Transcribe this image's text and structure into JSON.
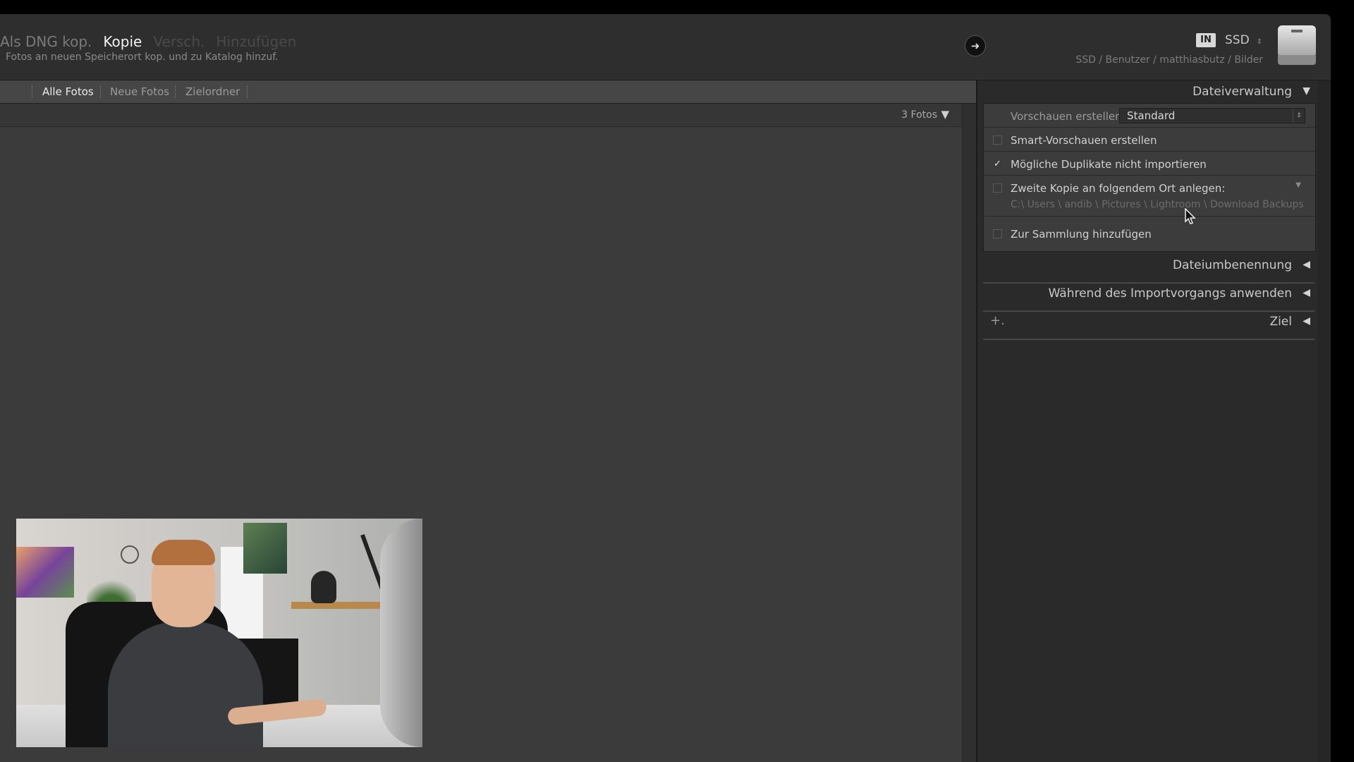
{
  "app": {
    "modes": [
      {
        "label": "Als DNG kop.",
        "state": "dng"
      },
      {
        "label": "Kopie",
        "state": "active"
      },
      {
        "label": "Versch.",
        "state": "dim"
      },
      {
        "label": "Hinzufügen",
        "state": "dim"
      }
    ],
    "mode_description": "Fotos an neuen Speicherort kop. und zu Katalog hinzuf.",
    "destination": {
      "badge": "IN",
      "drive": "SSD",
      "path": "SSD / Benutzer / matthiasbutz / Bilder",
      "go_icon": "arrow-right-circle-icon",
      "drive_icon": "hard-drive-icon"
    }
  },
  "filters": {
    "items": [
      "Alle Fotos",
      "Neue Fotos",
      "Zielordner"
    ],
    "active": "Alle Fotos"
  },
  "grid": {
    "photo_count": "3 Fotos"
  },
  "panel": {
    "file_handling": {
      "title": "Dateiverwaltung",
      "preview_label": "Vorschauen erstellen",
      "preview_value": "Standard",
      "smart_previews": {
        "label": "Smart-Vorschauen erstellen",
        "checked": false
      },
      "no_duplicates": {
        "label": "Mögliche Duplikate nicht importieren",
        "checked": true,
        "mark": "✓"
      },
      "second_copy": {
        "label": "Zweite Kopie an folgendem Ort anlegen:",
        "checked": false,
        "path": "C:\\ Users \\ andib \\ Pictures \\ Lightroom \\ Download Backups"
      },
      "add_to_collection": {
        "label": "Zur Sammlung hinzufügen",
        "checked": false
      }
    },
    "sections": [
      {
        "title": "Dateiumbenennung"
      },
      {
        "title": "Während des Importvorgangs anwenden"
      },
      {
        "title": "Ziel",
        "plus": "+."
      }
    ]
  },
  "colors": {
    "background": "#2b2b2b",
    "panel": "#3c3c3c",
    "text_active": "#f2f2f2",
    "text_dim": "#4a4a4a"
  }
}
